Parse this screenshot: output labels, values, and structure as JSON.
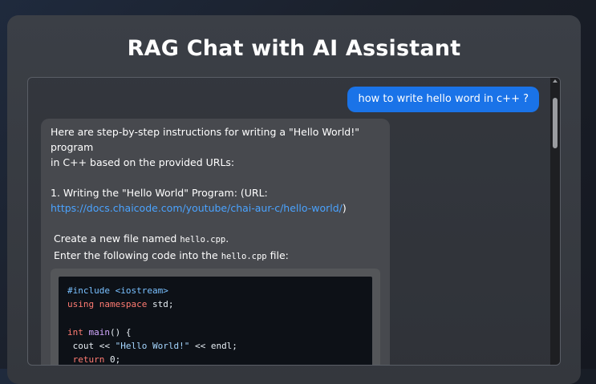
{
  "app": {
    "title": "RAG Chat with AI Assistant"
  },
  "chat": {
    "user_message": "how to write hello word in c++ ?",
    "assistant": {
      "intro_line1": "Here are step-by-step instructions for writing a \"Hello World!\" program",
      "intro_line2": "in C++ based on the provided URLs:",
      "step1_heading": "1. Writing the \"Hello World\" Program: (URL:",
      "step1_link": "https://docs.chaicode.com/youtube/chai-aur-c/hello-world/",
      "step1_link_close": ")",
      "create_prefix": "Create a new file named ",
      "create_file": "hello.cpp",
      "create_suffix": ".",
      "enter_prefix": "Enter the following code into the ",
      "enter_file": "hello.cpp",
      "enter_suffix": " file:",
      "code": {
        "line1_directive": "#include",
        "line1_header": " <iostream>",
        "line2_kw": "using namespace",
        "line2_rest": " std;",
        "line4_type": "int",
        "line4_fn": "main",
        "line4_rest": "() {",
        "line5_pre": " cout << ",
        "line5_str": "\"Hello World!\"",
        "line5_post": " << endl;",
        "line6_kw": " return",
        "line6_rest": " 0;"
      }
    }
  },
  "colors": {
    "accent": "#1a73e8",
    "link": "#4aa3ff",
    "panel": "#3b3f46",
    "code_bg": "#0d1117"
  }
}
